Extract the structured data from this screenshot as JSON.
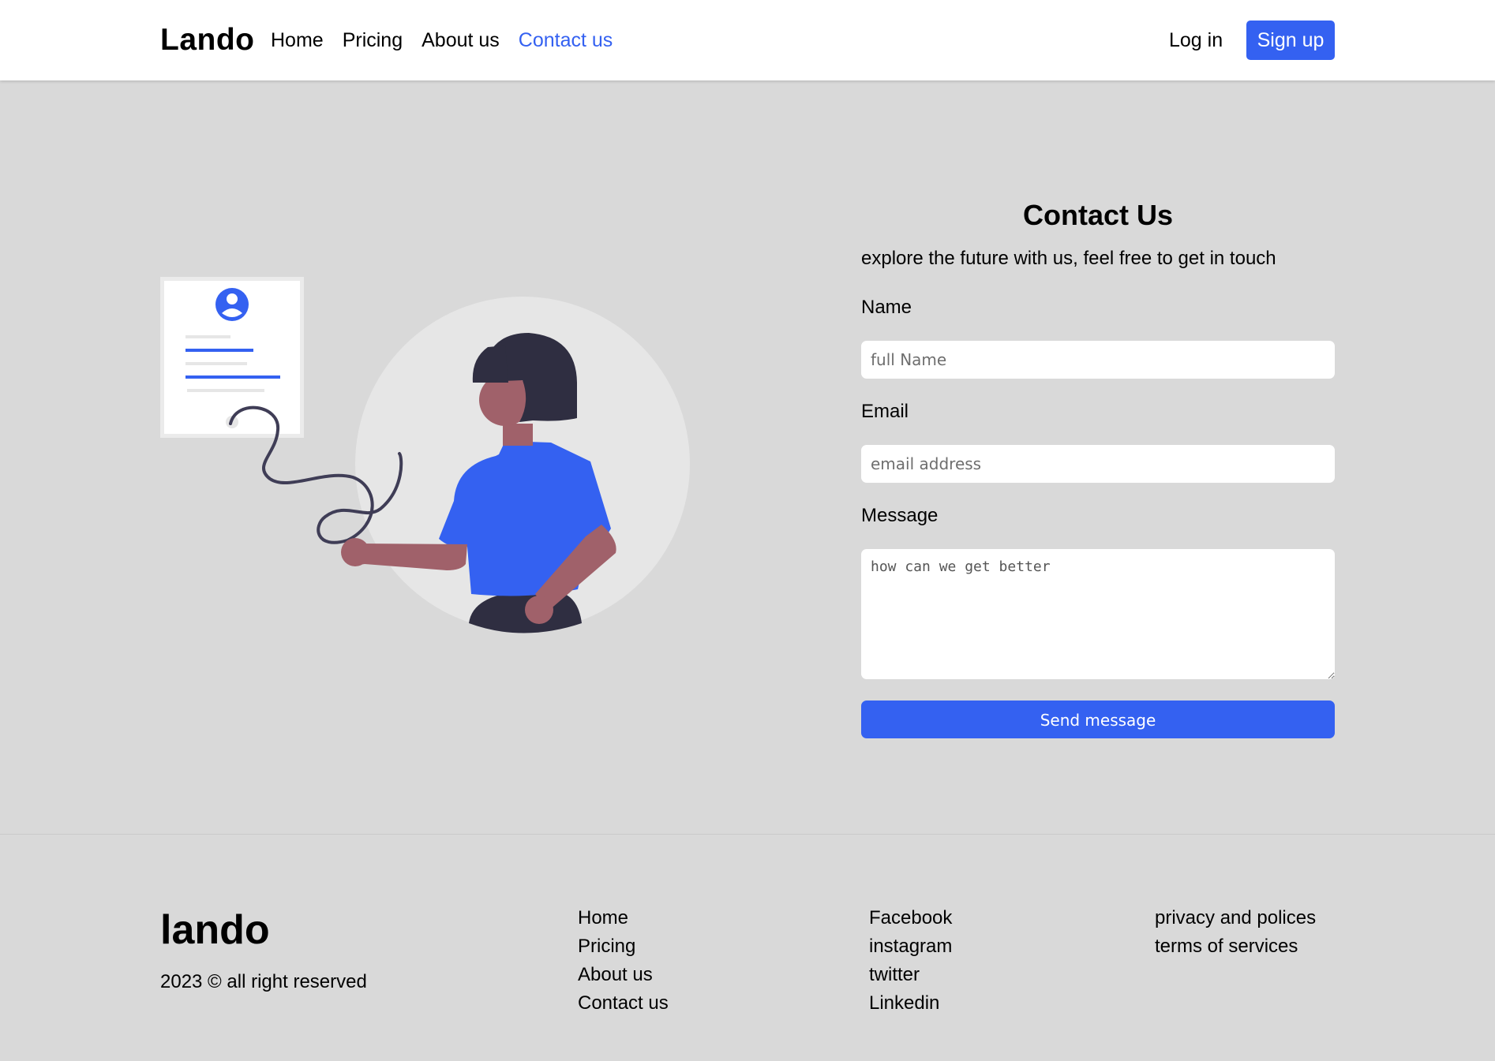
{
  "navbar": {
    "brand": "Lando",
    "links": [
      {
        "label": "Home",
        "active": false
      },
      {
        "label": "Pricing",
        "active": false
      },
      {
        "label": "About us",
        "active": false
      },
      {
        "label": "Contact us",
        "active": true
      }
    ],
    "login_label": "Log in",
    "signup_label": "Sign up"
  },
  "contact": {
    "title": "Contact Us",
    "subtitle": "explore the future with us, feel free to get in touch",
    "name_label": "Name",
    "name_placeholder": "full Name",
    "email_label": "Email",
    "email_placeholder": "email address",
    "message_label": "Message",
    "message_placeholder": "how can we get better",
    "send_label": "Send message"
  },
  "footer": {
    "brand": "lando",
    "copyright": "2023 © all right reserved",
    "nav_links": [
      "Home",
      "Pricing",
      "About us",
      "Contact us"
    ],
    "social_links": [
      "Facebook",
      "instagram",
      "twitter",
      "Linkedin"
    ],
    "legal_links": [
      "privacy and polices",
      "terms of services"
    ]
  },
  "colors": {
    "accent": "#3461f1",
    "page_bg": "#d9d9d9",
    "navbar_bg": "#ffffff",
    "skin": "#a0616a",
    "hair": "#2f2e41"
  },
  "icons": {
    "profile": "user-circle-icon",
    "resize": "resize-handle-icon"
  }
}
